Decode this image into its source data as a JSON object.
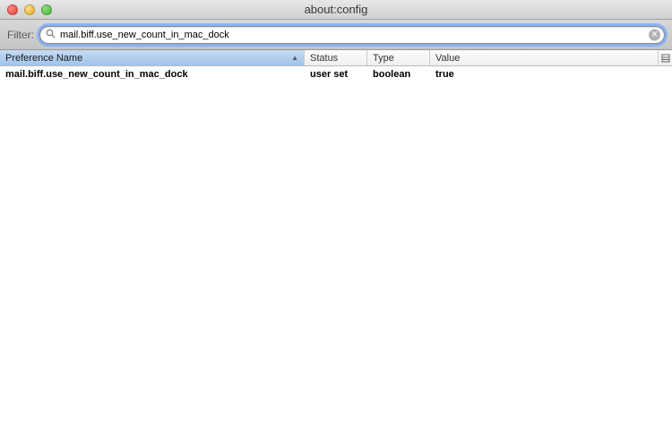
{
  "window": {
    "title": "about:config"
  },
  "toolbar": {
    "filter_label": "Filter:",
    "filter_value": "mail.biff.use_new_count_in_mac_dock"
  },
  "columns": {
    "name": "Preference Name",
    "status": "Status",
    "type": "Type",
    "value": "Value"
  },
  "rows": [
    {
      "name": "mail.biff.use_new_count_in_mac_dock",
      "status": "user set",
      "type": "boolean",
      "value": "true",
      "user_set": true
    }
  ]
}
